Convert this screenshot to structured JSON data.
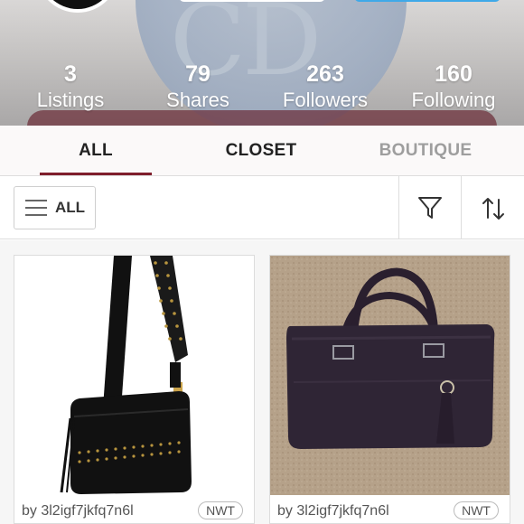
{
  "stats": [
    {
      "value": "3",
      "label": "Listings"
    },
    {
      "value": "79",
      "label": "Shares"
    },
    {
      "value": "263",
      "label": "Followers"
    },
    {
      "value": "160",
      "label": "Following"
    }
  ],
  "cover": {
    "logo_text": "CD"
  },
  "tabs": {
    "all": "ALL",
    "closet": "CLOSET",
    "boutique": "BOUTIQUE",
    "active": "ALL"
  },
  "filter": {
    "all_label": "ALL",
    "filter_icon": "filter-icon",
    "sort_icon": "sort-icon"
  },
  "listings": [
    {
      "image": "black studded crossbody bag",
      "username": "by 3l2igf7jkfq7n6l",
      "badge": "NWT"
    },
    {
      "image": "dark purple satchel handbag",
      "username": "by 3l2igf7jkfq7n6l",
      "badge": "NWT"
    }
  ],
  "colors": {
    "accent": "#7f1e2c",
    "follow_button": "#3fa9e8",
    "inactive_tab": "#9e9e9e"
  }
}
